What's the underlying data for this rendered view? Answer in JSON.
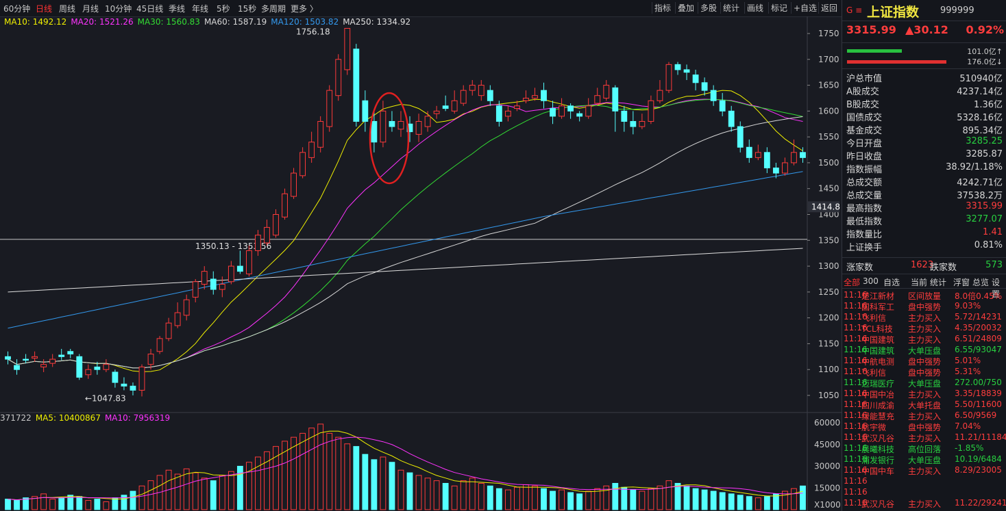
{
  "toolbar": {
    "periods": [
      "60分钟",
      "日线",
      "周线",
      "月线",
      "10分钟",
      "45日线",
      "季线",
      "年线",
      "5秒",
      "15秒",
      "多周期",
      "更多 〉"
    ],
    "active_period": "日线",
    "tools": [
      "指标",
      "叠加",
      "多股",
      "统计",
      "画线",
      "标记",
      "+自选",
      "返回"
    ]
  },
  "ma_legend": [
    {
      "label": "MA10: 1492.12",
      "color": "#f0f000"
    },
    {
      "label": "MA20: 1521.26",
      "color": "#ff33ff"
    },
    {
      "label": "MA30: 1560.83",
      "color": "#33dd33"
    },
    {
      "label": "MA60: 1587.19",
      "color": "#d8d8d8"
    },
    {
      "label": "MA120: 1503.82",
      "color": "#3399ee"
    },
    {
      "label": "MA250: 1334.92",
      "color": "#e0e0e0"
    }
  ],
  "price_axis": [
    "1750",
    "1700",
    "1650",
    "1600",
    "1550",
    "1500",
    "1450",
    "1400",
    "1350",
    "1300",
    "1250",
    "1200",
    "1150",
    "1100",
    "1050"
  ],
  "current_price_tag": "1414.8",
  "annotations": {
    "high": "1756.18",
    "low": "←1047.83",
    "range": "1350.13 - 1353.56"
  },
  "volume_legend": [
    {
      "label": "371722",
      "color": "#c8c8c8"
    },
    {
      "label": "MA5: 10400867",
      "color": "#f0f000"
    },
    {
      "label": "MA10: 7956319",
      "color": "#ff33ff"
    }
  ],
  "volume_axis": [
    "60000",
    "45000",
    "30000",
    "15000",
    "X1000"
  ],
  "chart_data": {
    "type": "candlestick",
    "candles": [
      [
        1125,
        1120,
        1135,
        1110
      ],
      [
        1108,
        1100,
        1120,
        1090
      ],
      [
        1120,
        1118,
        1130,
        1112
      ],
      [
        1122,
        1125,
        1135,
        1115
      ],
      [
        1105,
        1110,
        1120,
        1095
      ],
      [
        1112,
        1120,
        1130,
        1105
      ],
      [
        1128,
        1125,
        1140,
        1118
      ],
      [
        1135,
        1130,
        1140,
        1122
      ],
      [
        1125,
        1085,
        1130,
        1080
      ],
      [
        1090,
        1100,
        1110,
        1082
      ],
      [
        1105,
        1100,
        1115,
        1090
      ],
      [
        1100,
        1110,
        1120,
        1095
      ],
      [
        1095,
        1075,
        1100,
        1065
      ],
      [
        1072,
        1068,
        1085,
        1060
      ],
      [
        1068,
        1060,
        1075,
        1050
      ],
      [
        1060,
        1105,
        1110,
        1048
      ],
      [
        1110,
        1130,
        1140,
        1100
      ],
      [
        1135,
        1160,
        1165,
        1130
      ],
      [
        1160,
        1190,
        1200,
        1155
      ],
      [
        1185,
        1210,
        1230,
        1180
      ],
      [
        1205,
        1235,
        1245,
        1195
      ],
      [
        1240,
        1270,
        1275,
        1230
      ],
      [
        1265,
        1290,
        1300,
        1255
      ],
      [
        1275,
        1255,
        1290,
        1245
      ],
      [
        1255,
        1265,
        1280,
        1240
      ],
      [
        1270,
        1300,
        1310,
        1265
      ],
      [
        1300,
        1290,
        1330,
        1285
      ],
      [
        1285,
        1330,
        1340,
        1280
      ],
      [
        1330,
        1360,
        1370,
        1320
      ],
      [
        1345,
        1375,
        1390,
        1340
      ],
      [
        1360,
        1400,
        1410,
        1355
      ],
      [
        1395,
        1440,
        1450,
        1390
      ],
      [
        1435,
        1480,
        1490,
        1430
      ],
      [
        1475,
        1520,
        1530,
        1470
      ],
      [
        1510,
        1540,
        1560,
        1500
      ],
      [
        1530,
        1580,
        1590,
        1520
      ],
      [
        1570,
        1640,
        1650,
        1560
      ],
      [
        1630,
        1700,
        1710,
        1620
      ],
      [
        1680,
        1760,
        1756,
        1670
      ],
      [
        1720,
        1580,
        1730,
        1570
      ],
      [
        1620,
        1580,
        1640,
        1560
      ],
      [
        1580,
        1540,
        1600,
        1520
      ],
      [
        1540,
        1600,
        1620,
        1530
      ],
      [
        1580,
        1570,
        1600,
        1560
      ],
      [
        1565,
        1580,
        1600,
        1550
      ],
      [
        1575,
        1560,
        1590,
        1540
      ],
      [
        1555,
        1580,
        1595,
        1540
      ],
      [
        1570,
        1590,
        1600,
        1560
      ],
      [
        1595,
        1600,
        1610,
        1585
      ],
      [
        1610,
        1605,
        1630,
        1600
      ],
      [
        1600,
        1620,
        1640,
        1595
      ],
      [
        1615,
        1640,
        1650,
        1610
      ],
      [
        1640,
        1650,
        1660,
        1630
      ],
      [
        1630,
        1650,
        1660,
        1620
      ],
      [
        1640,
        1620,
        1650,
        1610
      ],
      [
        1610,
        1580,
        1620,
        1570
      ],
      [
        1590,
        1600,
        1610,
        1580
      ],
      [
        1605,
        1610,
        1620,
        1600
      ],
      [
        1620,
        1625,
        1640,
        1615
      ],
      [
        1625,
        1630,
        1645,
        1620
      ],
      [
        1640,
        1620,
        1655,
        1605
      ],
      [
        1605,
        1590,
        1620,
        1575
      ],
      [
        1590,
        1610,
        1625,
        1585
      ],
      [
        1610,
        1600,
        1615,
        1585
      ],
      [
        1595,
        1590,
        1600,
        1580
      ],
      [
        1590,
        1610,
        1625,
        1585
      ],
      [
        1615,
        1630,
        1645,
        1610
      ],
      [
        1625,
        1650,
        1660,
        1620
      ],
      [
        1645,
        1600,
        1650,
        1560
      ],
      [
        1600,
        1580,
        1610,
        1560
      ],
      [
        1580,
        1570,
        1600,
        1555
      ],
      [
        1570,
        1580,
        1595,
        1565
      ],
      [
        1580,
        1620,
        1630,
        1575
      ],
      [
        1620,
        1640,
        1660,
        1615
      ],
      [
        1640,
        1690,
        1695,
        1635
      ],
      [
        1690,
        1680,
        1695,
        1670
      ],
      [
        1680,
        1675,
        1690,
        1660
      ],
      [
        1670,
        1655,
        1680,
        1640
      ],
      [
        1655,
        1640,
        1665,
        1630
      ],
      [
        1640,
        1620,
        1650,
        1610
      ],
      [
        1620,
        1600,
        1635,
        1590
      ],
      [
        1600,
        1570,
        1610,
        1560
      ],
      [
        1570,
        1530,
        1580,
        1520
      ],
      [
        1530,
        1510,
        1545,
        1500
      ],
      [
        1510,
        1520,
        1535,
        1505
      ],
      [
        1520,
        1490,
        1530,
        1480
      ],
      [
        1490,
        1480,
        1500,
        1470
      ],
      [
        1480,
        1500,
        1510,
        1475
      ],
      [
        1500,
        1520,
        1545,
        1495
      ],
      [
        1520,
        1510,
        1530,
        1500
      ]
    ],
    "volume": [
      8,
      7,
      9,
      10,
      12,
      8,
      9,
      11,
      10,
      7,
      8,
      6,
      9,
      11,
      14,
      18,
      22,
      26,
      30,
      27,
      31,
      28,
      24,
      22,
      26,
      29,
      33,
      36,
      40,
      44,
      48,
      52,
      55,
      58,
      62,
      65,
      58,
      55,
      50,
      48,
      42,
      38,
      40,
      36,
      30,
      28,
      26,
      24,
      22,
      20,
      18,
      22,
      24,
      20,
      18,
      16,
      15,
      17,
      19,
      18,
      16,
      14,
      15,
      13,
      12,
      14,
      16,
      18,
      20,
      17,
      15,
      14,
      16,
      18,
      22,
      20,
      18,
      16,
      15,
      14,
      13,
      12,
      11,
      10,
      9,
      10,
      12,
      14,
      16,
      18
    ]
  },
  "quote": {
    "code_prefix": "G ≡",
    "name": "上证指数",
    "code": "999999",
    "price": "3315.99",
    "change": "▲30.12",
    "pct": "0.92%",
    "flow_up": "101.0亿↑",
    "flow_down": "176.0亿↓",
    "rows": [
      {
        "k": "沪总市值",
        "v": "510940亿",
        "c": "white"
      },
      {
        "k": "A股成交",
        "v": "4237.14亿",
        "c": "white"
      },
      {
        "k": "B股成交",
        "v": "1.36亿",
        "c": "white"
      },
      {
        "k": "国债成交",
        "v": "5328.16亿",
        "c": "white"
      },
      {
        "k": "基金成交",
        "v": "895.34亿",
        "c": "white"
      },
      {
        "k": "今日开盘",
        "v": "3285.25",
        "c": "green"
      },
      {
        "k": "昨日收盘",
        "v": "3285.87",
        "c": "white"
      },
      {
        "k": "指数振幅",
        "v": "38.92/1.18%",
        "c": "white"
      },
      {
        "k": "总成交额",
        "v": "4242.71亿",
        "c": "white"
      },
      {
        "k": "总成交量",
        "v": "37538.2万",
        "c": "white"
      },
      {
        "k": "最高指数",
        "v": "3315.99",
        "c": "red"
      },
      {
        "k": "最低指数",
        "v": "3277.07",
        "c": "green"
      },
      {
        "k": "指数量比",
        "v": "1.41",
        "c": "red"
      },
      {
        "k": "上证换手",
        "v": "0.81%",
        "c": "white"
      }
    ],
    "up_label": "涨家数",
    "up_val": "1623",
    "down_label": "跌家数",
    "down_val": "573"
  },
  "tabs": [
    "全部",
    "300",
    "自选",
    "当前",
    "统计",
    "浮窗",
    "总览",
    "设置"
  ],
  "alerts": [
    {
      "t": "11:16",
      "n": "楚江新材",
      "e": "区间放量",
      "v": "8.0倍0.45%",
      "c": "red"
    },
    {
      "t": "11:16",
      "n": "国科军工",
      "e": "盘中强势",
      "v": "9.03%",
      "c": "red"
    },
    {
      "t": "11:16",
      "n": "飞利信",
      "e": "主力买入",
      "v": "5.72/14231",
      "c": "red"
    },
    {
      "t": "11:16",
      "n": "TCL科技",
      "e": "主力买入",
      "v": "4.35/20032",
      "c": "red"
    },
    {
      "t": "11:16",
      "n": "中国建筑",
      "e": "主力买入",
      "v": "6.51/24809",
      "c": "red"
    },
    {
      "t": "11:16",
      "n": "中国建筑",
      "e": "大单压盘",
      "v": "6.55/93047",
      "c": "green"
    },
    {
      "t": "11:16",
      "n": "中航电测",
      "e": "盘中强势",
      "v": "5.01%",
      "c": "red"
    },
    {
      "t": "11:16",
      "n": "飞利信",
      "e": "盘中强势",
      "v": "5.31%",
      "c": "red"
    },
    {
      "t": "11:16",
      "n": "迈瑞医疗",
      "e": "大单压盘",
      "v": "272.00/750",
      "c": "green"
    },
    {
      "t": "11:16",
      "n": "中国中冶",
      "e": "主力买入",
      "v": "3.35/18839",
      "c": "red"
    },
    {
      "t": "11:16",
      "n": "四川成渝",
      "e": "大单托盘",
      "v": "5.50/11600",
      "c": "red"
    },
    {
      "t": "11:16",
      "n": "绿能慧充",
      "e": "主力买入",
      "v": "6.50/9569",
      "c": "red"
    },
    {
      "t": "11:16",
      "n": "航宇微",
      "e": "盘中强势",
      "v": "7.04%",
      "c": "red"
    },
    {
      "t": "11:16",
      "n": "武汉凡谷",
      "e": "主力买入",
      "v": "11.21/11184",
      "c": "red"
    },
    {
      "t": "11:16",
      "n": "晨曦科技",
      "e": "高位回落",
      "v": "-1.85%",
      "c": "green"
    },
    {
      "t": "11:16",
      "n": "浦发银行",
      "e": "大单压盘",
      "v": "10.19/6484",
      "c": "green"
    },
    {
      "t": "11:16",
      "n": "中国中车",
      "e": "主力买入",
      "v": "8.29/23005",
      "c": "red"
    },
    {
      "t": "11:16",
      "n": "",
      "e": "",
      "v": "",
      "c": "red"
    },
    {
      "t": "11:16",
      "n": "",
      "e": "",
      "v": "",
      "c": "red"
    },
    {
      "t": "11:16",
      "n": "武汉凡谷",
      "e": "主力买入",
      "v": "11.22/29241",
      "c": "red"
    }
  ]
}
